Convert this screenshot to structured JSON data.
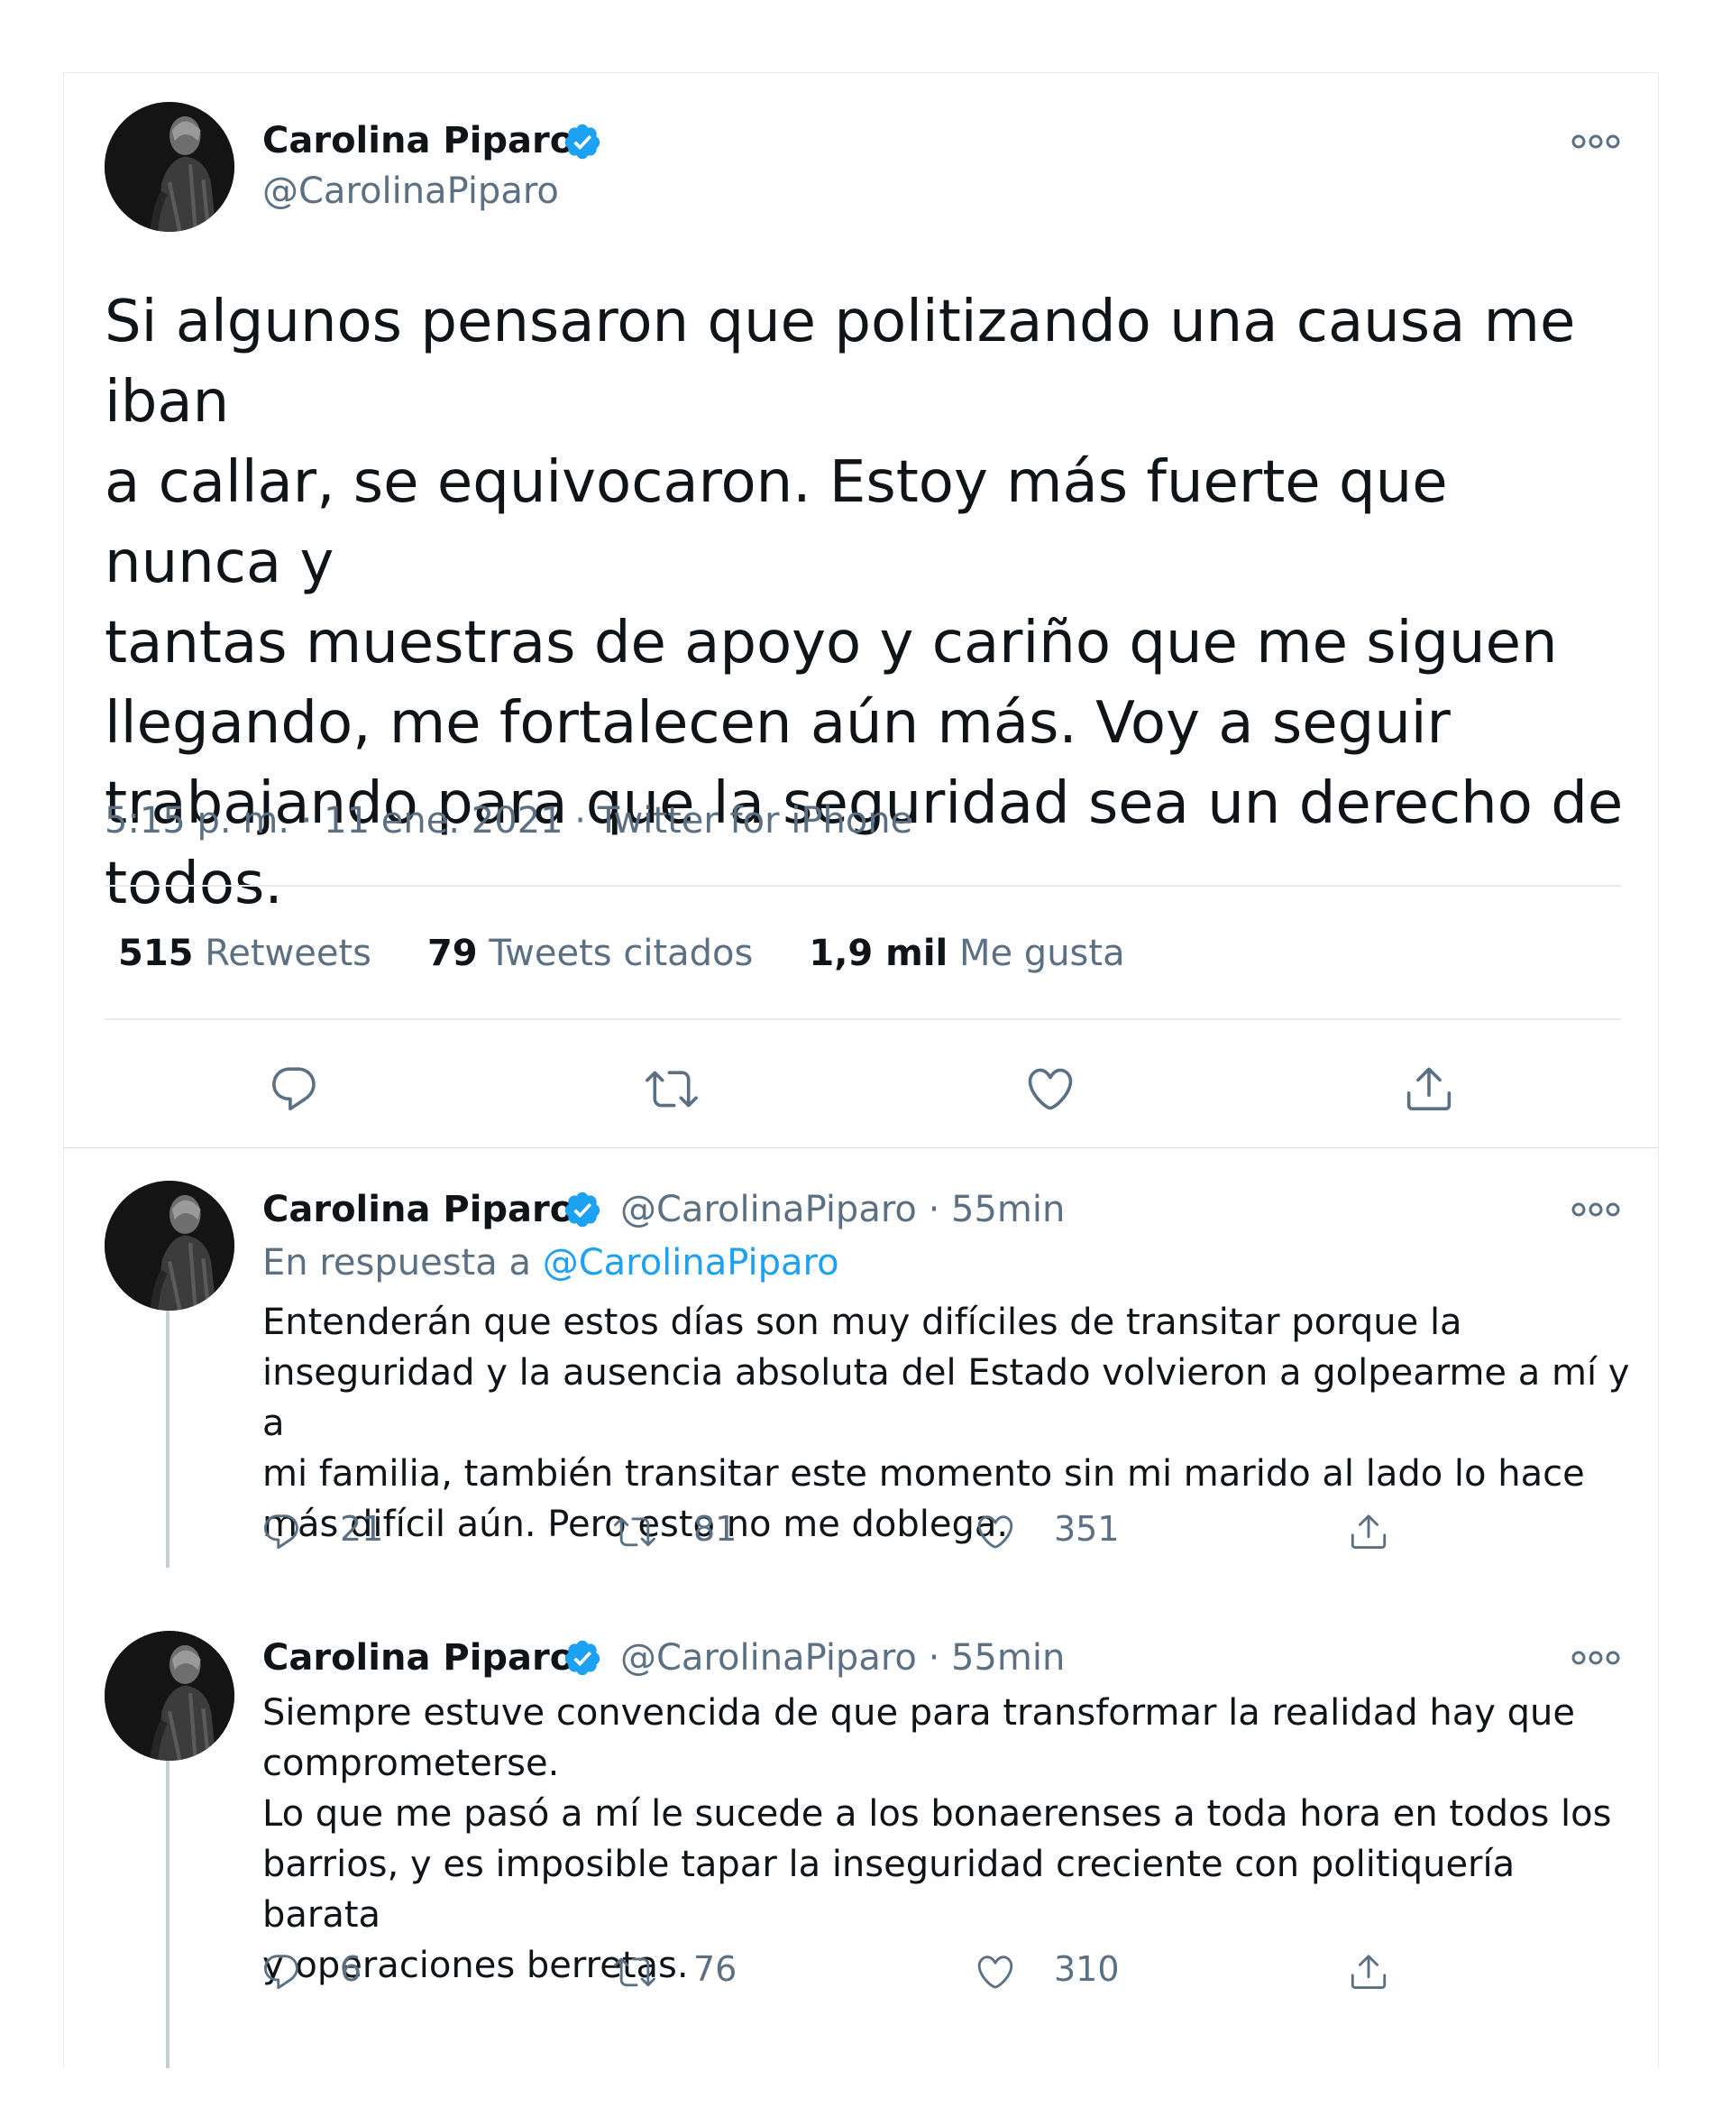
{
  "main_tweet": {
    "author_name": "Carolina Piparo",
    "author_handle": "@CarolinaPiparo",
    "text": "Si algunos pensaron que politizando una causa me iban\na callar, se equivocaron. Estoy más fuerte que nunca y\ntantas muestras de apoyo y cariño que me siguen\nllegando, me fortalecen aún más. Voy a seguir\ntrabajando para que la seguridad sea un derecho de\ntodos.",
    "timestamp": "5:15 p. m. · 11 ene. 2021 · Twitter for iPhone",
    "stats": {
      "retweets_count": "515",
      "retweets_label": "Retweets",
      "quotes_count": "79",
      "quotes_label": "Tweets citados",
      "likes_count": "1,9 mil",
      "likes_label": "Me gusta"
    }
  },
  "replies": [
    {
      "author_name": "Carolina Piparo",
      "author_handle": "@CarolinaPiparo",
      "time": "· 55min",
      "reply_to_label": "En respuesta a",
      "reply_to_handle": "@CarolinaPiparo",
      "text": "Entenderán que estos días son muy difíciles de transitar porque la\ninseguridad y la ausencia absoluta del Estado volvieron a golpearme a mí y a\nmi familia, también transitar este momento sin mi marido al lado lo hace\nmás difícil aún. Pero esto no me doblega.",
      "reply_count": "21",
      "retweet_count": "81",
      "like_count": "351"
    },
    {
      "author_name": "Carolina Piparo",
      "author_handle": "@CarolinaPiparo",
      "time": "· 55min",
      "text": "Siempre estuve convencida de que para transformar la realidad hay que\ncomprometerse.\nLo que me pasó a mí le sucede a los bonaerenses a toda hora en todos los\nbarrios, y es imposible tapar la inseguridad creciente con politiquería barata\ny operaciones berretas.",
      "reply_count": "6",
      "retweet_count": "76",
      "like_count": "310"
    }
  ],
  "colors": {
    "text_primary": "#0f1419",
    "text_secondary": "#5b7083",
    "link": "#1da1f2",
    "verified_badge": "#1da1f2",
    "divider": "#e6ecf0"
  },
  "icons": [
    "verified-badge-icon",
    "more-options-icon",
    "reply-icon",
    "retweet-icon",
    "like-icon",
    "share-icon"
  ]
}
